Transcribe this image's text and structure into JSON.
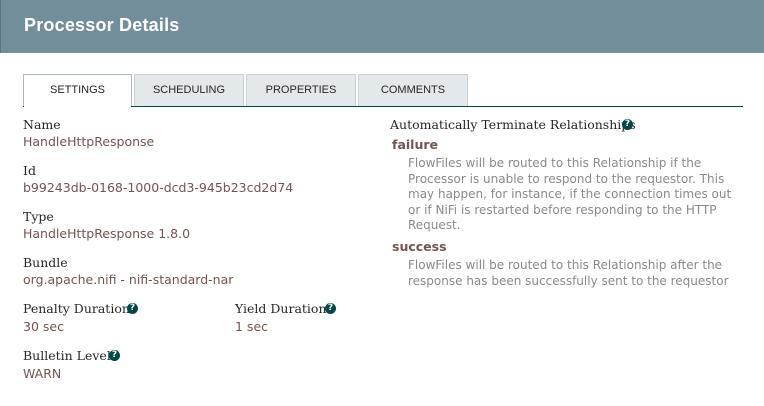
{
  "dialog": {
    "title": "Processor Details"
  },
  "tabs": [
    {
      "label": "SETTINGS"
    },
    {
      "label": "SCHEDULING"
    },
    {
      "label": "PROPERTIES"
    },
    {
      "label": "COMMENTS"
    }
  ],
  "settings": {
    "name_label": "Name",
    "name_value": "HandleHttpResponse",
    "id_label": "Id",
    "id_value": "b99243db-0168-1000-dcd3-945b23cd2d74",
    "type_label": "Type",
    "type_value": "HandleHttpResponse 1.8.0",
    "bundle_label": "Bundle",
    "bundle_value": "org.apache.nifi - nifi-standard-nar",
    "penalty_label": "Penalty Duration",
    "penalty_value": "30 sec",
    "yield_label": "Yield Duration",
    "yield_value": "1 sec",
    "bulletin_label": "Bulletin Level",
    "bulletin_value": "WARN",
    "help_glyph": "?"
  },
  "relationships": {
    "title": "Automatically Terminate Relationships",
    "items": [
      {
        "name": "failure",
        "description": "FlowFiles will be routed to this Relationship if the Processor is unable to respond to the requestor. This may happen, for instance, if the connection times out or if NiFi is restarted before responding to the HTTP Request."
      },
      {
        "name": "success",
        "description": "FlowFiles will be routed to this Relationship after the response has been successfully sent to the requestor"
      }
    ]
  }
}
